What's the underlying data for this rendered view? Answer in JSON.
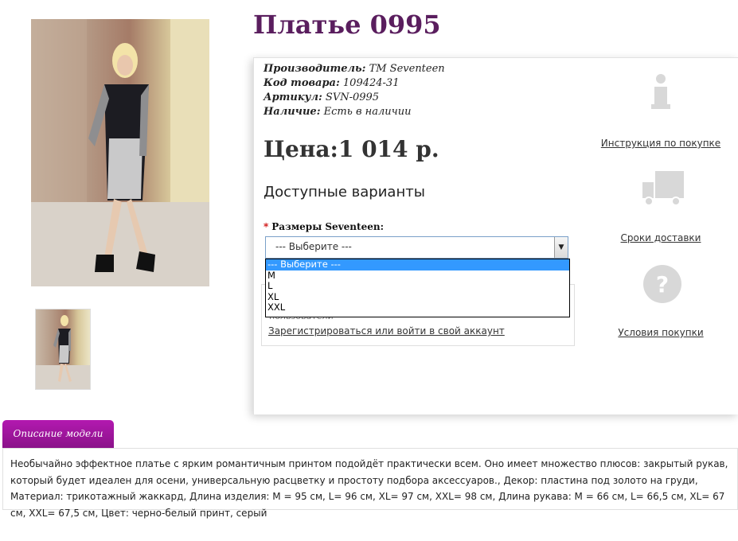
{
  "product": {
    "title": "Платье 0995",
    "manufacturer_label": "Производитель:",
    "manufacturer_value": "ТМ Seventeen",
    "code_label": "Код товара:",
    "code_value": "109424-31",
    "sku_label": "Артикул:",
    "sku_value": "SVN-0995",
    "stock_label": "Наличие:",
    "stock_value": "Есть в наличии",
    "price": "Цена:1 014 р."
  },
  "options": {
    "heading": "Доступные варианты",
    "required_mark": "*",
    "sizes_label": "Размеры Seventeen:",
    "selected": "--- Выберите ---",
    "dropdown_items": [
      "--- Выберите ---",
      "M",
      "L",
      "XL",
      "XXL"
    ]
  },
  "login": {
    "note": "пользователи",
    "link": "Зарегистрироваться или войти в свой аккаунт"
  },
  "sidebar": {
    "instruction": "Инструкция по покупке",
    "delivery": "Сроки доставки",
    "conditions": "Условия покупки"
  },
  "description": {
    "tab": "Описание модели",
    "text": "Необычайно эффектное платье с ярким романтичным принтом подойдёт практически всем. Оно имеет множество плюсов: закрытый рукав, который будет идеален для осени, универсальную расцветку и простоту подбора аксессуаров., Декор: пластина под золото на груди, Материал: трикотажный жаккард, Длина изделия: M = 95 см, L= 96 см, XL= 97 см, XXL= 98 см, Длина рукава: M = 66 см, L= 66,5 см, XL= 67 см, XXL= 67,5 см, Цвет: черно-белый принт, серый"
  },
  "icons": {
    "instruction": "info-icon",
    "delivery": "truck-icon",
    "conditions": "question-icon"
  },
  "colors": {
    "title": "#5a1e5e",
    "tab": "#9c169a",
    "highlight": "#3399ff"
  }
}
